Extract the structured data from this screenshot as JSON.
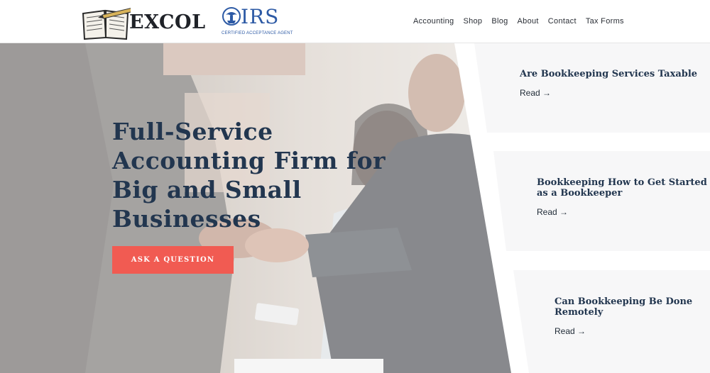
{
  "brand": {
    "name": "EXCOL"
  },
  "irs": {
    "name": "IRS",
    "subtitle": "CERTIFIED ACCEPTANCE AGENT"
  },
  "nav": {
    "items": [
      {
        "label": "Accounting"
      },
      {
        "label": "Shop"
      },
      {
        "label": "Blog"
      },
      {
        "label": "About"
      },
      {
        "label": "Contact"
      },
      {
        "label": "Tax Forms"
      }
    ]
  },
  "hero": {
    "title_lines": [
      "Full-Service",
      "Accounting Firm for",
      "Big and Small",
      "Businesses"
    ],
    "cta_label": "ASK A QUESTION"
  },
  "posts": [
    {
      "title_lines": [
        "Are Bookkeeping Services Taxable"
      ],
      "read_label": "Read →"
    },
    {
      "title_lines": [
        "Bookkeeping How to Get Started",
        "as a Bookkeeper"
      ],
      "read_label": "Read →"
    },
    {
      "title_lines": [
        "Can Bookkeeping Be Done",
        "Remotely"
      ],
      "read_label": "Read →"
    }
  ],
  "colors": {
    "accent": "#f15b52",
    "heading": "#22364f",
    "irs_blue": "#2d5aa5"
  }
}
